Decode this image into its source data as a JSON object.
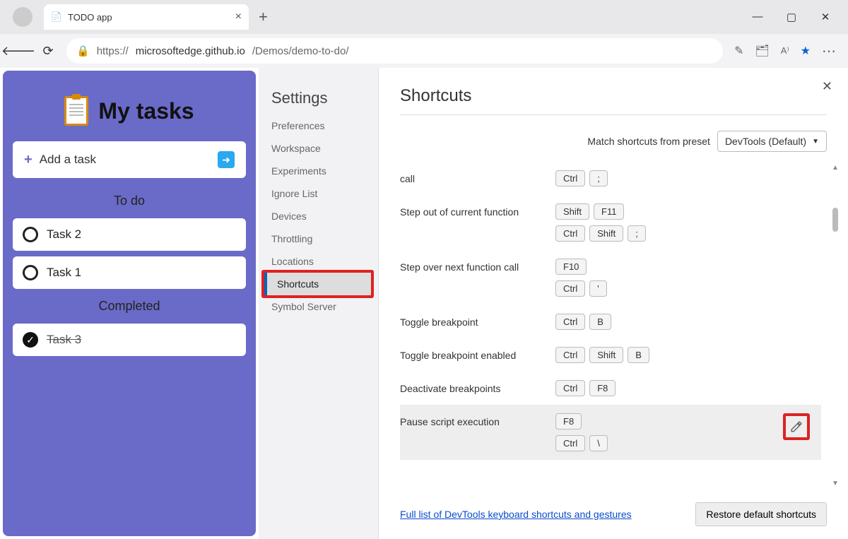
{
  "browser": {
    "tab_title": "TODO app",
    "url_host": "microsoftedge.github.io",
    "url_prefix": "https://",
    "url_path": "/Demos/demo-to-do/"
  },
  "todo": {
    "title": "My tasks",
    "add_placeholder": "Add a task",
    "sections": {
      "todo_label": "To do",
      "completed_label": "Completed"
    },
    "tasks_todo": [
      "Task 2",
      "Task 1"
    ],
    "tasks_done": [
      "Task 3"
    ]
  },
  "settings": {
    "heading": "Settings",
    "items": [
      "Preferences",
      "Workspace",
      "Experiments",
      "Ignore List",
      "Devices",
      "Throttling",
      "Locations",
      "Shortcuts",
      "Symbol Server"
    ],
    "selected_index": 7
  },
  "panel": {
    "title": "Shortcuts",
    "preset_label": "Match shortcuts from preset",
    "preset_value": "DevTools (Default)",
    "link_text": "Full list of DevTools keyboard shortcuts and gestures",
    "restore_label": "Restore default shortcuts",
    "rows": [
      {
        "label": "call",
        "keysets": [
          [
            "Ctrl",
            ";"
          ]
        ]
      },
      {
        "label": "Step out of current function",
        "keysets": [
          [
            "Shift",
            "F11"
          ],
          [
            "Ctrl",
            "Shift",
            ";"
          ]
        ]
      },
      {
        "label": "Step over next function call",
        "keysets": [
          [
            "F10"
          ],
          [
            "Ctrl",
            "'"
          ]
        ]
      },
      {
        "label": "Toggle breakpoint",
        "keysets": [
          [
            "Ctrl",
            "B"
          ]
        ]
      },
      {
        "label": "Toggle breakpoint enabled",
        "keysets": [
          [
            "Ctrl",
            "Shift",
            "B"
          ]
        ]
      },
      {
        "label": "Deactivate breakpoints",
        "keysets": [
          [
            "Ctrl",
            "F8"
          ]
        ]
      },
      {
        "label": "Pause script execution",
        "keysets": [
          [
            "F8"
          ],
          [
            "Ctrl",
            "\\"
          ]
        ],
        "highlighted": true,
        "editable": true
      }
    ]
  }
}
